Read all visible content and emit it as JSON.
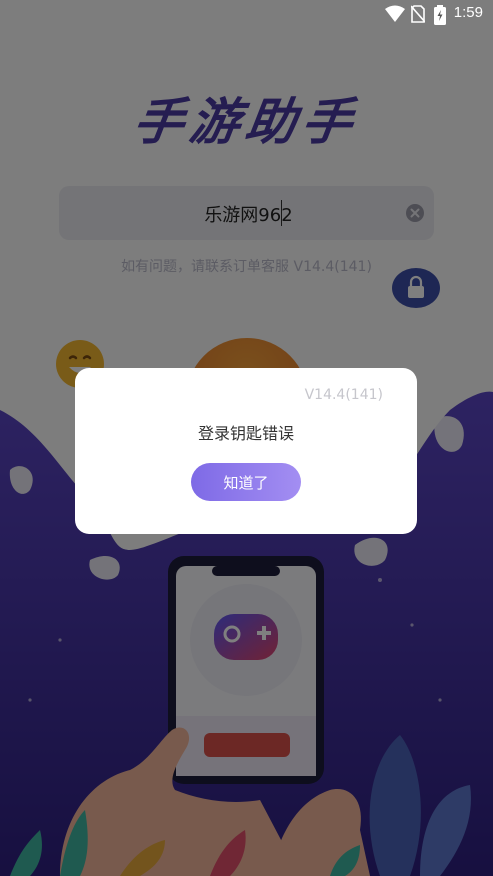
{
  "status_bar": {
    "time": "1:59"
  },
  "app": {
    "title": "手游助手"
  },
  "login": {
    "input_value": "乐游网962",
    "help_text": "如有问题，请联系订单客服 V14.4(141)"
  },
  "dialog": {
    "version": "V14.4(141)",
    "message": "登录钥匙错误",
    "confirm_label": "知道了"
  },
  "colors": {
    "accent": "#7e6ae6",
    "title": "#4a3aa2",
    "illustration_bg": "#3b2a8c"
  }
}
